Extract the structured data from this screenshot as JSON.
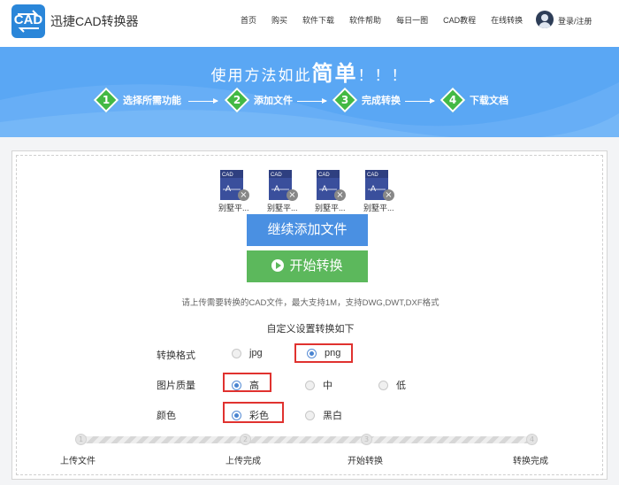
{
  "header": {
    "logo_text": "CAD",
    "brand": "迅捷CAD转换器",
    "nav": [
      "首页",
      "购买",
      "软件下载",
      "软件帮助",
      "每日一图",
      "CAD教程",
      "在线转换"
    ],
    "login": "登录/注册"
  },
  "banner": {
    "title_prefix": "使用方法如此",
    "title_big": "简单",
    "title_suffix": "！！！",
    "steps": [
      {
        "num": "1",
        "label": "选择所需功能"
      },
      {
        "num": "2",
        "label": "添加文件"
      },
      {
        "num": "3",
        "label": "完成转换"
      },
      {
        "num": "4",
        "label": "下载文档"
      }
    ]
  },
  "files": [
    {
      "icon_label": "CAD",
      "name": "别墅平..."
    },
    {
      "icon_label": "CAD",
      "name": "别墅平..."
    },
    {
      "icon_label": "CAD",
      "name": "别墅平..."
    },
    {
      "icon_label": "CAD",
      "name": "别墅平..."
    }
  ],
  "buttons": {
    "add_more": "继续添加文件",
    "start": "开始转换"
  },
  "hint": "请上传需要转换的CAD文件，最大支持1M，支持DWG,DWT,DXF格式",
  "settings": {
    "title": "自定义设置转换如下",
    "rows": [
      {
        "label": "转换格式",
        "options": [
          "jpg",
          "png"
        ],
        "selected": "png"
      },
      {
        "label": "图片质量",
        "options": [
          "高",
          "中",
          "低"
        ],
        "selected": "高"
      },
      {
        "label": "颜色",
        "options": [
          "彩色",
          "黑白"
        ],
        "selected": "彩色"
      }
    ]
  },
  "progress": {
    "steps": [
      {
        "num": "1",
        "label": "上传文件"
      },
      {
        "num": "2",
        "label": "上传完成"
      },
      {
        "num": "3",
        "label": "开始转换"
      },
      {
        "num": "4",
        "label": "转换完成"
      }
    ]
  },
  "colors": {
    "brand_blue": "#2a86d9",
    "banner_blue": "#5aa7f4",
    "step_green": "#43b944",
    "add_button": "#4a90e2",
    "start_button": "#5cb85c",
    "highlight_red": "#e0322f"
  }
}
